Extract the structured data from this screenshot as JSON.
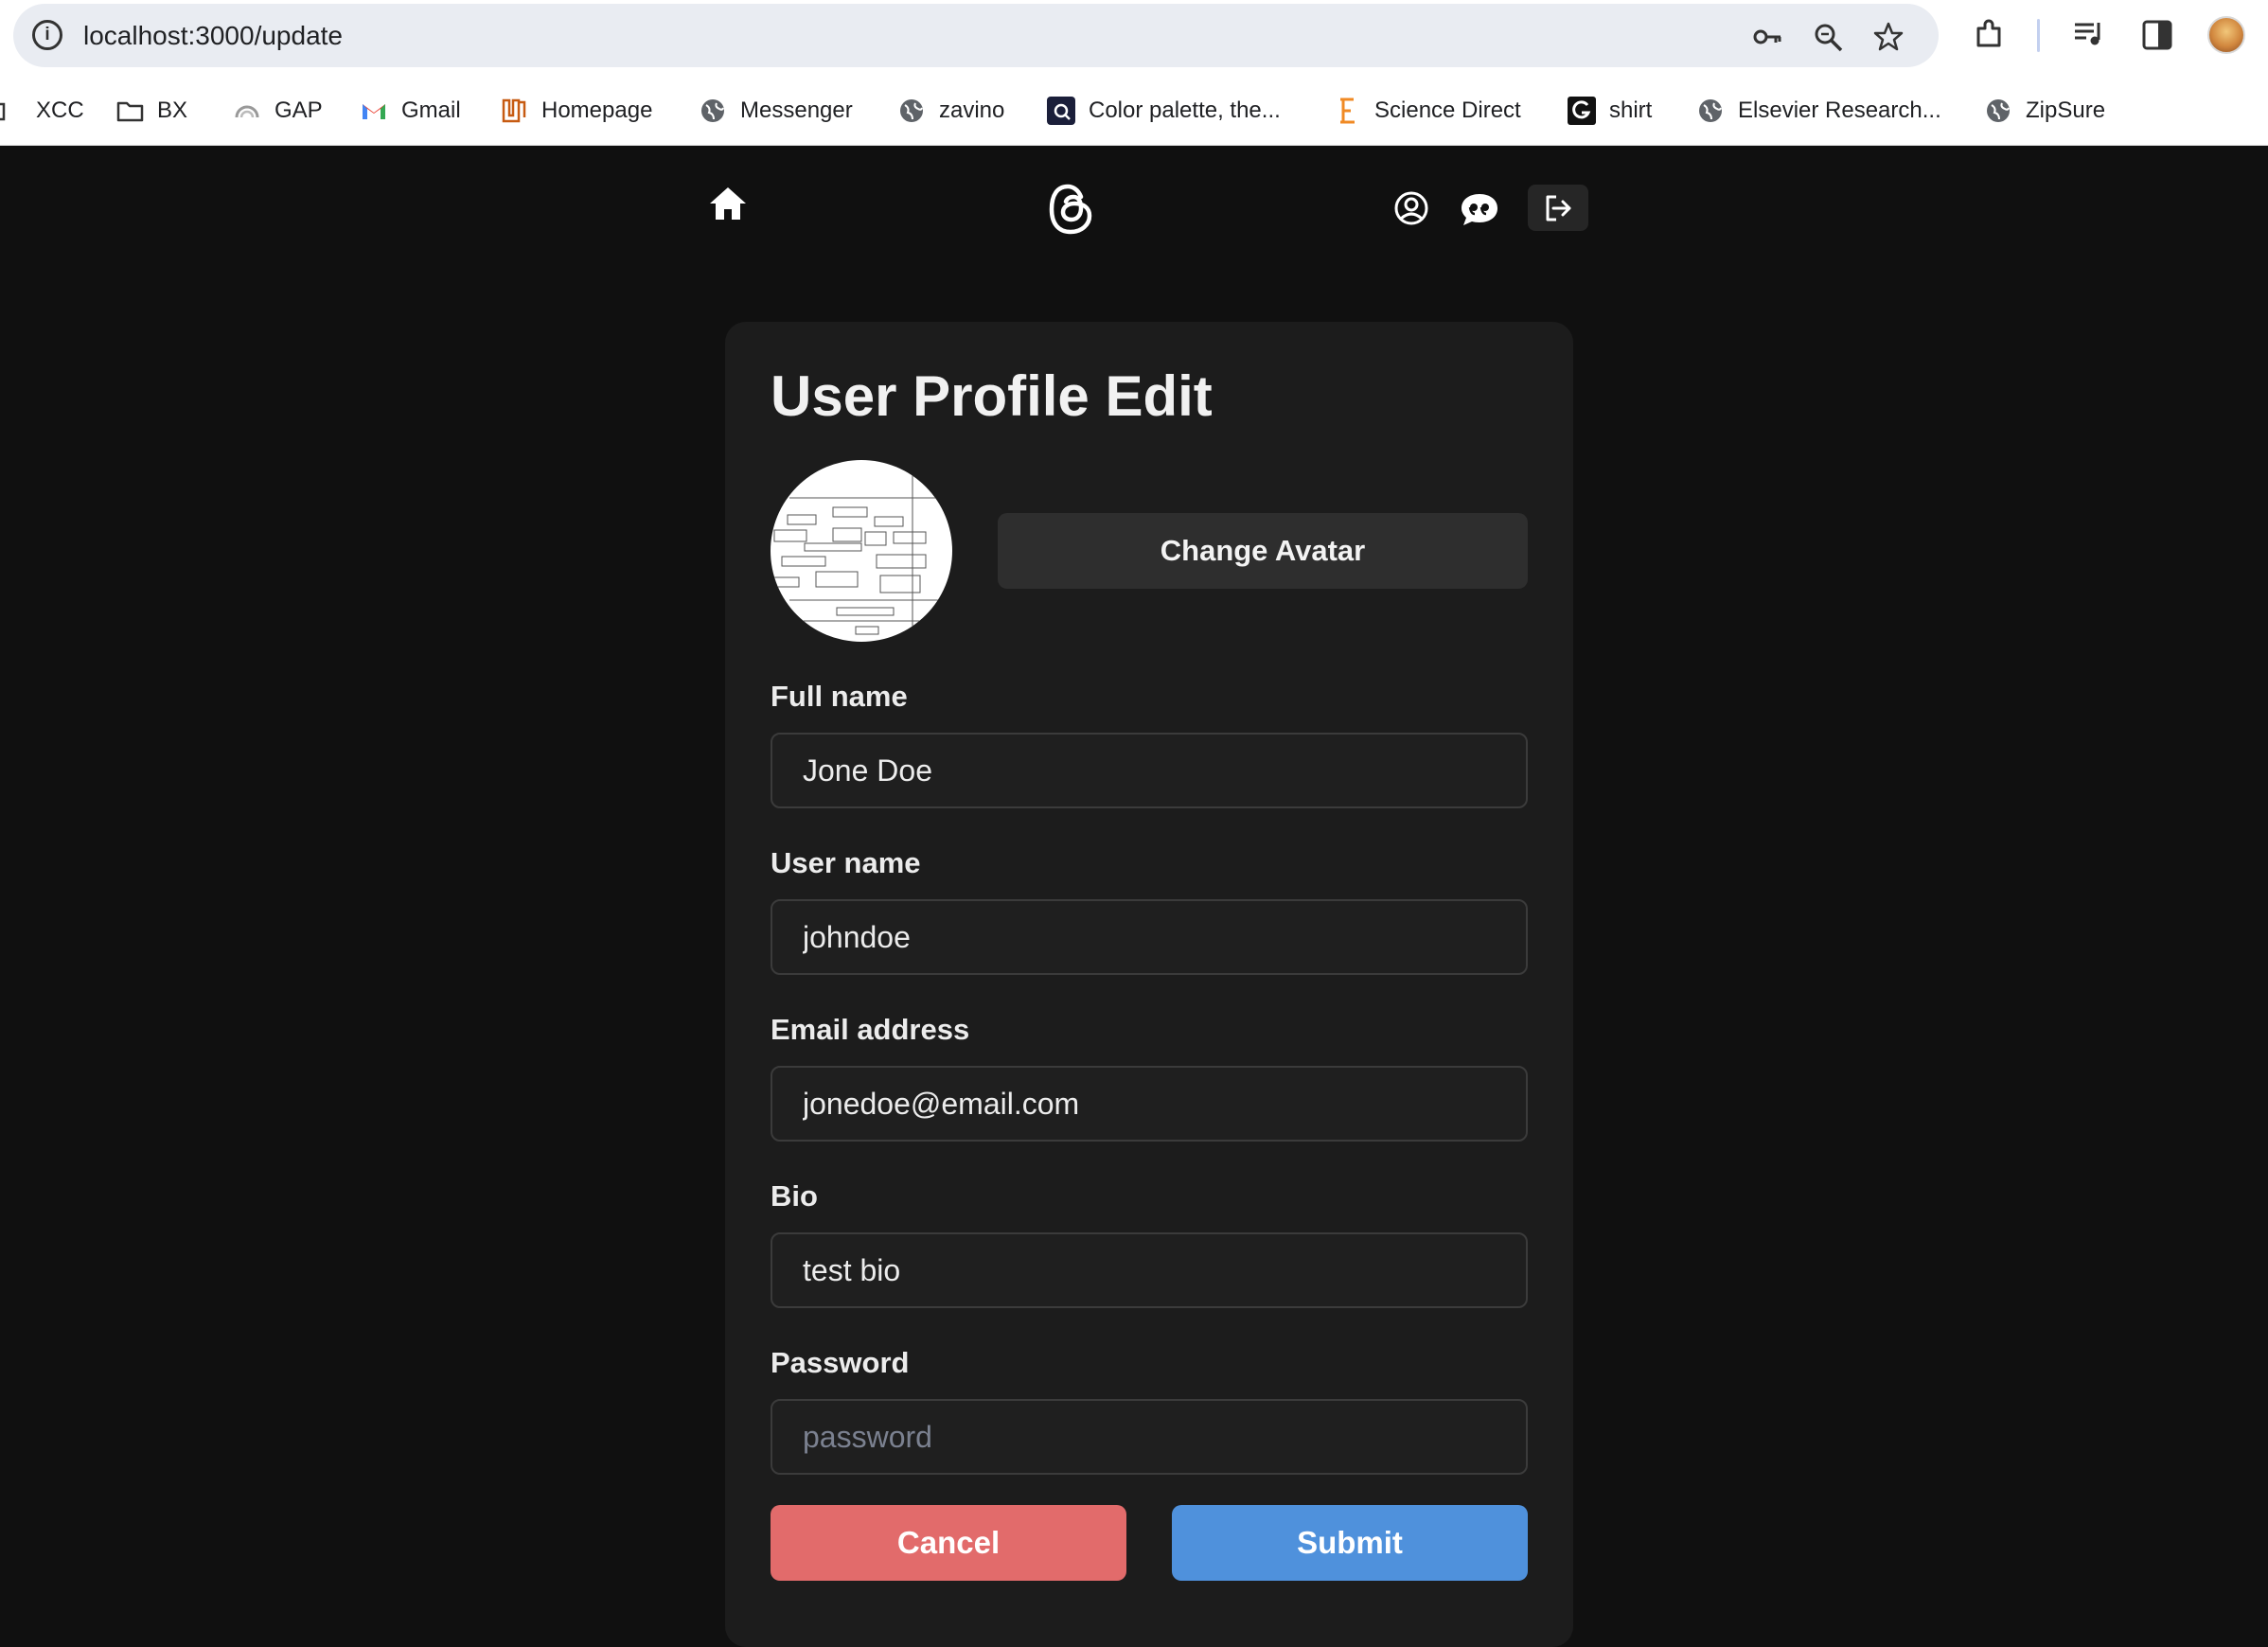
{
  "browser": {
    "url": "localhost:3000/update",
    "bookmarks": [
      {
        "label": "XCC",
        "icon": "folder-icon"
      },
      {
        "label": "BX",
        "icon": "folder-icon"
      },
      {
        "label": "GAP",
        "icon": "gauge-icon"
      },
      {
        "label": "Gmail",
        "icon": "gmail-icon"
      },
      {
        "label": "Homepage",
        "icon": "utd-logo-icon"
      },
      {
        "label": "Messenger",
        "icon": "globe-icon"
      },
      {
        "label": "zavino",
        "icon": "globe-icon"
      },
      {
        "label": "Color palette, the...",
        "icon": "palette-icon"
      },
      {
        "label": "Science Direct",
        "icon": "elsevier-e-icon"
      },
      {
        "label": "shirt",
        "icon": "g-logo-icon"
      },
      {
        "label": "Elsevier Research...",
        "icon": "globe-icon"
      },
      {
        "label": "ZipSure",
        "icon": "globe-icon"
      }
    ]
  },
  "nav": {
    "home_icon": "home-icon",
    "logo_icon": "threads-logo-icon",
    "profile_icon": "user-circle-icon",
    "chat_icon": "chat-quote-icon",
    "logout_icon": "logout-icon"
  },
  "form": {
    "title": "User Profile Edit",
    "change_avatar_label": "Change Avatar",
    "fields": [
      {
        "label": "Full name",
        "value": "Jone Doe",
        "placeholder": ""
      },
      {
        "label": "User name",
        "value": "johndoe",
        "placeholder": ""
      },
      {
        "label": "Email address",
        "value": "jonedoe@email.com",
        "placeholder": ""
      },
      {
        "label": "Bio",
        "value": "test bio",
        "placeholder": ""
      },
      {
        "label": "Password",
        "value": "",
        "placeholder": "password"
      }
    ],
    "cancel_label": "Cancel",
    "submit_label": "Submit"
  },
  "colors": {
    "page_bg": "#101010",
    "card_bg": "#1c1c1c",
    "cancel": "#e26b6b",
    "submit": "#4f91dc"
  }
}
